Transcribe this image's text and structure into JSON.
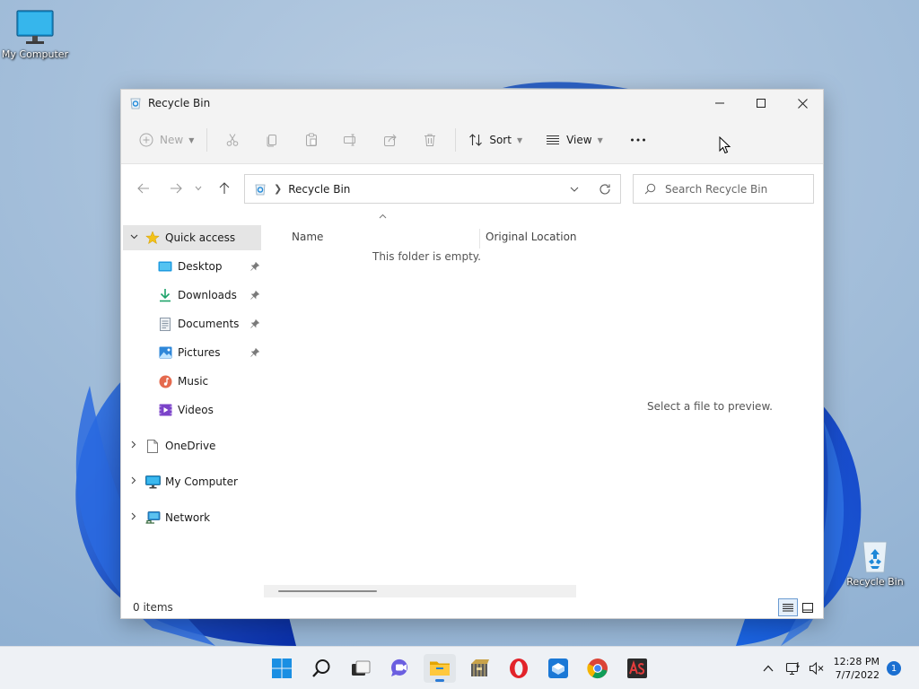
{
  "desktop": {
    "icons": [
      {
        "label": "My Computer"
      },
      {
        "label": "Recycle Bin"
      }
    ]
  },
  "window": {
    "title": "Recycle Bin",
    "toolbar": {
      "new_label": "New",
      "sort_label": "Sort",
      "view_label": "View"
    },
    "address": {
      "crumb": "Recycle Bin"
    },
    "search": {
      "placeholder": "Search Recycle Bin"
    },
    "sidebar": {
      "items": [
        {
          "label": "Quick access",
          "icon": "star-icon"
        },
        {
          "label": "Desktop",
          "icon": "desktop-folder-icon",
          "pinned": true
        },
        {
          "label": "Downloads",
          "icon": "download-icon",
          "pinned": true
        },
        {
          "label": "Documents",
          "icon": "documents-icon",
          "pinned": true
        },
        {
          "label": "Pictures",
          "icon": "pictures-icon",
          "pinned": true
        },
        {
          "label": "Music",
          "icon": "music-icon"
        },
        {
          "label": "Videos",
          "icon": "videos-icon"
        },
        {
          "label": "OneDrive",
          "icon": "onedrive-icon"
        },
        {
          "label": "My Computer",
          "icon": "computer-icon"
        },
        {
          "label": "Network",
          "icon": "network-icon"
        }
      ]
    },
    "columns": {
      "name": "Name",
      "original_location": "Original Location"
    },
    "empty_message": "This folder is empty.",
    "preview_message": "Select a file to preview.",
    "status": {
      "item_count": "0 items"
    }
  },
  "taskbar": {
    "clock": {
      "time": "12:28 PM",
      "date": "7/7/2022"
    },
    "notification_count": "1"
  },
  "colors": {
    "accent": "#0067c0",
    "selection": "#e5e5e5"
  }
}
